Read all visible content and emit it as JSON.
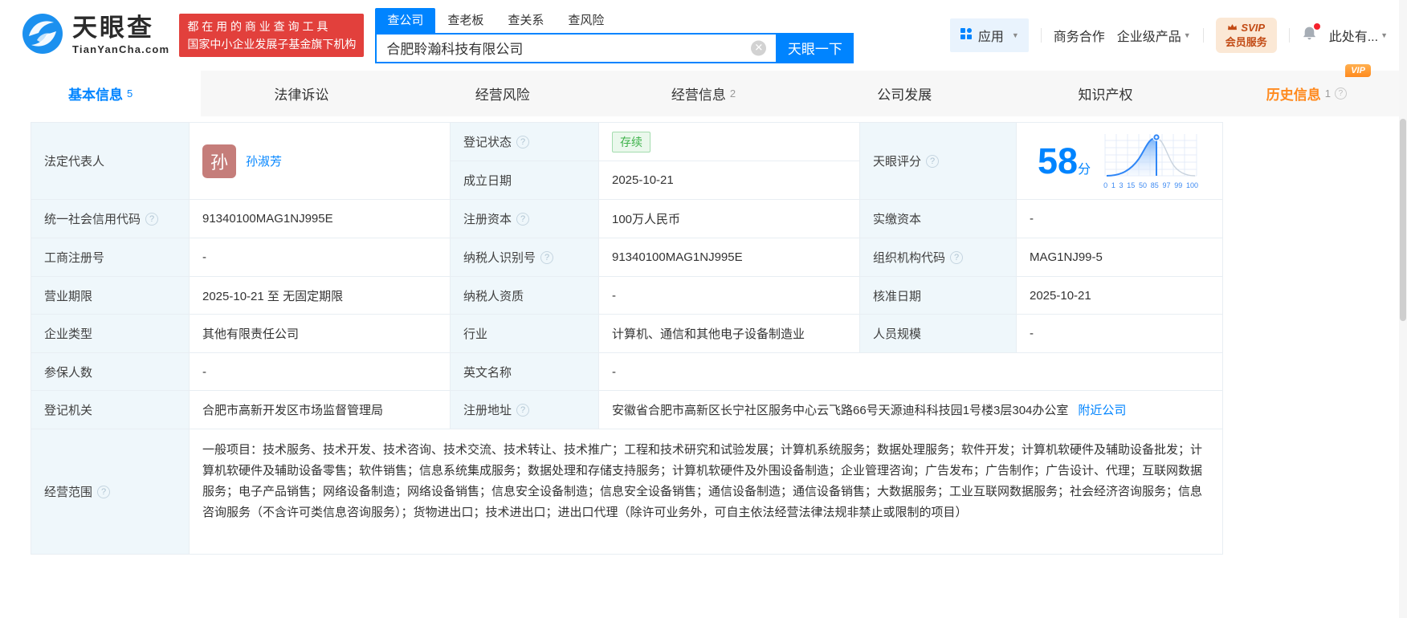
{
  "brand": {
    "name": "天眼查",
    "domain": "TianYanCha.com",
    "slogan_line1": "都 在 用 的 商 业 查 询 工 具",
    "slogan_line2": "国家中小企业发展子基金旗下机构"
  },
  "search": {
    "tabs": [
      {
        "label": "查公司"
      },
      {
        "label": "查老板"
      },
      {
        "label": "查关系"
      },
      {
        "label": "查风险"
      }
    ],
    "value": "合肥聆瀚科技有限公司",
    "button_label": "天眼一下"
  },
  "nav": {
    "apps": "应用",
    "business": "商务合作",
    "enterprise": "企业级产品",
    "svip_line1": "SVIP",
    "svip_line2": "会员服务",
    "account": "此处有..."
  },
  "tabs": [
    {
      "label": "基本信息",
      "count": "5"
    },
    {
      "label": "法律诉讼",
      "count": ""
    },
    {
      "label": "经营风险",
      "count": ""
    },
    {
      "label": "经营信息",
      "count": "2"
    },
    {
      "label": "公司发展",
      "count": ""
    },
    {
      "label": "知识产权",
      "count": ""
    },
    {
      "label": "历史信息",
      "count": "1",
      "badge": "VIP"
    }
  ],
  "company": {
    "legal_rep": {
      "label": "法定代表人",
      "avatar": "孙",
      "name": "孙淑芳"
    },
    "reg_status": {
      "label": "登记状态",
      "value": "存续"
    },
    "est_date": {
      "label": "成立日期",
      "value": "2025-10-21"
    },
    "score": {
      "label": "天眼评分",
      "value": "58",
      "unit": "分",
      "axis": [
        "0",
        "1",
        "3",
        "15",
        "50",
        "85",
        "97",
        "99",
        "100"
      ]
    },
    "credit_code": {
      "label": "统一社会信用代码",
      "value": "91340100MAG1NJ995E"
    },
    "reg_capital": {
      "label": "注册资本",
      "value": "100万人民币"
    },
    "paid_capital": {
      "label": "实缴资本",
      "value": "-"
    },
    "reg_no": {
      "label": "工商注册号",
      "value": "-"
    },
    "taxpayer_no": {
      "label": "纳税人识别号",
      "value": "91340100MAG1NJ995E"
    },
    "org_code": {
      "label": "组织机构代码",
      "value": "MAG1NJ99-5"
    },
    "term": {
      "label": "营业期限",
      "value": "2025-10-21 至 无固定期限"
    },
    "taxpayer_qualification": {
      "label": "纳税人资质",
      "value": "-"
    },
    "approval_date": {
      "label": "核准日期",
      "value": "2025-10-21"
    },
    "company_type": {
      "label": "企业类型",
      "value": "其他有限责任公司"
    },
    "industry": {
      "label": "行业",
      "value": "计算机、通信和其他电子设备制造业"
    },
    "staff_size": {
      "label": "人员规模",
      "value": "-"
    },
    "insured_num": {
      "label": "参保人数",
      "value": "-"
    },
    "english_name": {
      "label": "英文名称",
      "value": "-"
    },
    "reg_authority": {
      "label": "登记机关",
      "value": "合肥市高新开发区市场监督管理局"
    },
    "address": {
      "label": "注册地址",
      "value": "安徽省合肥市高新区长宁社区服务中心云飞路66号天源迪科科技园1号楼3层304办公室",
      "nearby": "附近公司"
    },
    "scope": {
      "label": "经营范围",
      "value": "一般项目：技术服务、技术开发、技术咨询、技术交流、技术转让、技术推广；工程和技术研究和试验发展；计算机系统服务；数据处理服务；软件开发；计算机软硬件及辅助设备批发；计算机软硬件及辅助设备零售；软件销售；信息系统集成服务；数据处理和存储支持服务；计算机软硬件及外围设备制造；企业管理咨询；广告发布；广告制作；广告设计、代理；互联网数据服务；电子产品销售；网络设备制造；网络设备销售；信息安全设备制造；信息安全设备销售；通信设备制造；通信设备销售；大数据服务；工业互联网数据服务；社会经济咨询服务；信息咨询服务（不含许可类信息咨询服务）；货物进出口；技术进出口；进出口代理（除许可业务外，可自主依法经营法律法规非禁止或限制的项目）"
    }
  },
  "colors": {
    "primary": "#0084ff",
    "banner_red": "#e2403c",
    "status_green": "#3eb24a",
    "vip_orange": "#ff8a1e"
  }
}
